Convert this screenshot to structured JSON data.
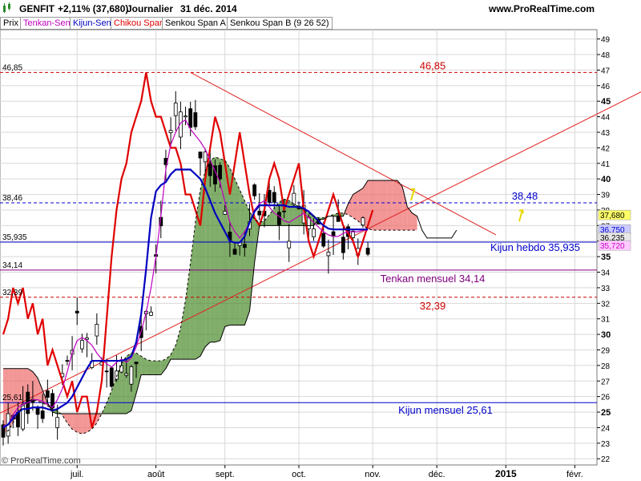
{
  "header": {
    "symbol": "GENFIT",
    "change": "+2,11% (37,680)",
    "period": "Journalier",
    "date": "31 déc. 2014",
    "site": "www.ProRealTime.com"
  },
  "legend": [
    {
      "label": "Prix",
      "color": "#000000"
    },
    {
      "label": "Tenkan-Sen",
      "color": "#c000c0"
    },
    {
      "label": "Kijun-Sen",
      "color": "#0000c0"
    },
    {
      "label": "Chikou Span",
      "color": "#e00000"
    },
    {
      "label": "Senkou Span A",
      "color": "#000000"
    },
    {
      "label": "Senkou Span B (9 26 52)",
      "color": "#000000"
    }
  ],
  "watermark": "© ProRealTime.com",
  "chart_data": {
    "type": "candlestick",
    "x_labels": [
      "juil.",
      "août",
      "sept.",
      "oct.",
      "nov.",
      "déc.",
      "2015",
      "févr."
    ],
    "y_ticks": [
      22,
      23,
      24,
      25,
      26,
      27,
      28,
      29,
      30,
      31,
      32,
      33,
      34,
      35,
      36,
      37,
      38,
      39,
      40,
      41,
      42,
      43,
      44,
      45,
      46,
      47,
      48,
      49
    ],
    "ylim": [
      21.6,
      49.6
    ],
    "grid": true,
    "horizontal_levels": [
      {
        "value": 46.85,
        "label_left": "46,85",
        "label_mid": "46,85",
        "color": "#cc0000",
        "style": "dashed"
      },
      {
        "value": 38.46,
        "label_left": "38,46",
        "label_mid": "38,48",
        "color": "#0000cc",
        "style": "dashed"
      },
      {
        "value": 35.935,
        "label_left": "35,935",
        "label_mid": "Kijun hebdo 35,935",
        "color": "#0000cc",
        "style": "solid"
      },
      {
        "value": 34.14,
        "label_left": "34,14",
        "label_mid": "Tenkan mensuel 34,14",
        "color": "#800080",
        "style": "solid"
      },
      {
        "value": 32.39,
        "label_left": "32,39",
        "label_mid": "32,39",
        "color": "#cc0000",
        "style": "dashed"
      },
      {
        "value": 25.61,
        "label_left": "25,61",
        "label_mid": "Kijun mensuel 25,61",
        "color": "#0000cc",
        "style": "solid"
      }
    ],
    "price_labels": [
      {
        "value": 37.68,
        "text": "37,680",
        "bg": "#ffff66"
      },
      {
        "value": 36.75,
        "text": "36,750",
        "bg": "#ccccff"
      },
      {
        "value": 36.235,
        "text": "36,235",
        "bg": "#e8e8e8"
      },
      {
        "value": 35.72,
        "text": "35,720",
        "bg": "#ffccff"
      }
    ],
    "price_label_colors": {
      "36,750": "#0000cc",
      "35,720": "#cc00cc"
    },
    "trendlines": [
      {
        "from": [
          -4,
          24.4
        ],
        "to": [
          132,
          46.0
        ]
      },
      {
        "from": [
          38,
          46.85
        ],
        "to": [
          100,
          36.4
        ]
      }
    ],
    "ohlc": [],
    "series": [
      {
        "name": "Chikou Span",
        "color": "#e00000",
        "values": [
          30,
          31,
          33,
          32,
          33,
          31,
          32,
          30,
          31,
          28,
          29,
          28,
          27,
          26,
          27,
          25,
          26,
          26,
          24,
          25,
          27,
          31,
          35,
          38,
          40,
          41,
          43,
          44,
          45,
          46.85,
          45,
          44,
          44,
          43,
          42,
          42,
          41,
          39,
          39,
          38,
          37,
          40,
          42,
          44,
          43,
          41,
          39,
          41,
          43,
          41,
          39,
          37.5,
          37,
          38,
          40,
          41,
          40,
          38,
          39,
          40,
          41,
          38,
          36,
          35,
          36,
          37,
          38,
          39,
          38,
          37,
          36.5,
          36,
          35,
          36,
          37,
          38
        ]
      },
      {
        "name": "Tenkan-Sen",
        "color": "#c000c0",
        "values": [
          24.1,
          24.2,
          24.8,
          25.3,
          25.5,
          25.6,
          25.8,
          25.8,
          25.7,
          25.5,
          25.3,
          25.8,
          26.5,
          27.6,
          28.8,
          29.6,
          29.8,
          29.6,
          29.3,
          28.8,
          28.4,
          28.1,
          27.9,
          28.2,
          28.4,
          28.2,
          28.5,
          29.2,
          30.2,
          31.4,
          33.0,
          35.0,
          37.6,
          40.6,
          42.2,
          43.0,
          43.6,
          43.8,
          43.2,
          42.8,
          42.4,
          41.9,
          41.2,
          40.5,
          39.8,
          38.5,
          37.2,
          36.6,
          36.2,
          36.6,
          37.2,
          38.0,
          38.4,
          38.6,
          38.2,
          37.8,
          37.6,
          37.3,
          37.2,
          37.4,
          37.6,
          37.8,
          37.5,
          37.2,
          36.9,
          36.6,
          36.4,
          36.3,
          36.3,
          36.5,
          36.6,
          36.6,
          36.6,
          36.7,
          36.7
        ]
      },
      {
        "name": "Kijun-Sen",
        "color": "#0000c0",
        "values": [
          24.0,
          24.2,
          24.6,
          25.0,
          25.2,
          25.2,
          25.3,
          25.3,
          25.3,
          25.2,
          25.1,
          25.2,
          25.4,
          25.6,
          26.0,
          26.6,
          27.2,
          27.8,
          28.3,
          28.3,
          28.3,
          28.3,
          28.3,
          28.3,
          28.3,
          28.4,
          28.6,
          29.5,
          31.3,
          34.2,
          37.5,
          39.2,
          39.6,
          39.8,
          40.3,
          40.6,
          40.6,
          40.6,
          40.6,
          40.3,
          40.0,
          39.4,
          38.6,
          37.8,
          37.2,
          36.6,
          36.0,
          35.9,
          35.9,
          36.3,
          37.2,
          37.9,
          38.3,
          38.3,
          38.3,
          38.3,
          38.3,
          38.3,
          38.2,
          38.2,
          38.2,
          38.1,
          37.9,
          37.6,
          37.3,
          37.0,
          36.8,
          36.75,
          36.75,
          36.75,
          36.75,
          36.75,
          36.75,
          36.75,
          36.75
        ]
      },
      {
        "name": "Senkou Span A",
        "color": "#000000",
        "values": [
          23.6,
          23.8,
          24.3,
          24.9,
          25.4,
          25.7,
          25.8,
          25.7,
          25.6,
          25.4,
          25.2,
          25.1,
          24.8,
          24.3,
          23.9,
          23.7,
          23.6,
          23.7,
          23.9,
          24.3,
          24.9,
          25.6,
          26.4,
          27.3,
          28.1,
          28.6,
          28.8,
          28.8,
          28.6,
          28.4,
          28.3,
          28.3,
          28.3,
          28.4,
          28.7,
          29.3,
          30.4,
          32.2,
          34.6,
          37.2,
          39.3,
          40.5,
          41.2,
          41.4,
          41.3,
          41.2,
          40.7,
          40.0,
          39.3,
          38.6,
          37.9,
          37.4,
          37.2,
          37.3,
          37.7,
          38.1,
          38.5,
          38.7,
          38.6,
          38.4,
          38.2,
          38.0,
          37.8,
          37.6,
          37.5,
          37.5,
          37.6,
          37.7,
          37.8,
          37.8,
          37.7,
          37.5,
          37.3,
          37.0,
          36.8,
          36.7,
          36.7,
          36.7,
          36.7,
          36.7,
          36.7,
          36.7,
          36.7,
          36.7,
          36.7
        ]
      },
      {
        "name": "Senkou Span B (9 26 52)",
        "color": "#000000",
        "values": [
          27.8,
          27.8,
          27.8,
          27.8,
          27.8,
          27.8,
          27.6,
          27.2,
          26.4,
          25.6,
          25.0,
          24.9,
          24.9,
          24.9,
          24.9,
          24.9,
          24.9,
          24.9,
          24.9,
          24.9,
          24.9,
          24.9,
          24.9,
          24.9,
          24.9,
          24.9,
          25.1,
          26.2,
          27.4,
          27.4,
          27.4,
          27.4,
          27.4,
          27.8,
          28.4,
          28.4,
          28.4,
          28.4,
          28.4,
          28.4,
          28.6,
          29.2,
          29.5,
          29.5,
          29.6,
          30.5,
          30.6,
          30.6,
          30.6,
          30.6,
          31.5,
          34.6,
          37.0,
          37.0,
          37.0,
          37.0,
          37.0,
          37.0,
          37.0,
          37.0,
          37.0,
          37.0,
          37.0,
          37.0,
          37.4,
          37.4,
          37.6,
          37.6,
          37.6,
          37.6,
          38.4,
          39.0,
          39.2,
          39.4,
          39.9,
          39.9,
          39.9,
          39.9,
          39.9,
          39.9,
          39.9,
          39.5,
          38.2,
          37.8,
          37.6,
          36.7,
          36.2,
          36.2,
          36.2,
          36.2,
          36.2,
          36.2,
          36.7
        ]
      }
    ]
  }
}
